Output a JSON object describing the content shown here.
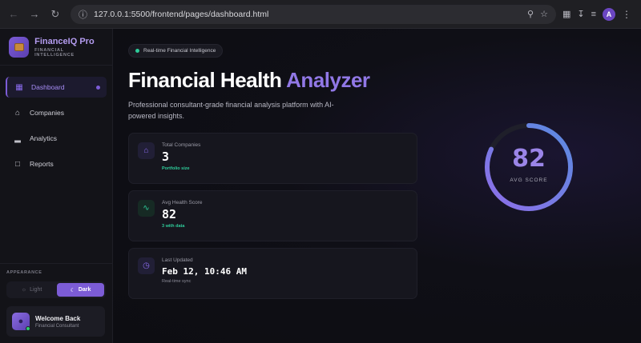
{
  "browser": {
    "url": "127.0.0.1:5500/frontend/pages/dashboard.html",
    "profile_initial": "A"
  },
  "sidebar": {
    "brand_name": "FinanceIQ Pro",
    "brand_sub": "FINANCIAL INTELLIGENCE",
    "items": [
      {
        "label": "Dashboard",
        "icon": "grid-icon",
        "active": true
      },
      {
        "label": "Companies",
        "icon": "home-icon",
        "active": false
      },
      {
        "label": "Analytics",
        "icon": "bar-chart-icon",
        "active": false
      },
      {
        "label": "Reports",
        "icon": "document-icon",
        "active": false
      }
    ],
    "appearance_label": "APPEARANCE",
    "theme_light": "Light",
    "theme_dark": "Dark",
    "user_name": "Welcome Back",
    "user_role": "Financial Consultant"
  },
  "main": {
    "live_badge": "Real-time Financial Intelligence",
    "title_primary": "Financial Health",
    "title_accent": "Analyzer",
    "subtitle": "Professional consultant-grade financial analysis platform with AI-powered insights.",
    "cards": [
      {
        "label": "Total Companies",
        "value": "3",
        "sub": "Portfolio size"
      },
      {
        "label": "Avg Health Score",
        "value": "82",
        "sub": "3 with data"
      },
      {
        "label": "Last Updated",
        "value": "Feb 12, 10:46 AM",
        "sub": "Real-time sync"
      }
    ],
    "gauge": {
      "value": "82",
      "label": "AVG SCORE",
      "fraction": 0.82
    }
  },
  "colors": {
    "accent": "#7c5cd6",
    "success": "#2ecc9a"
  }
}
